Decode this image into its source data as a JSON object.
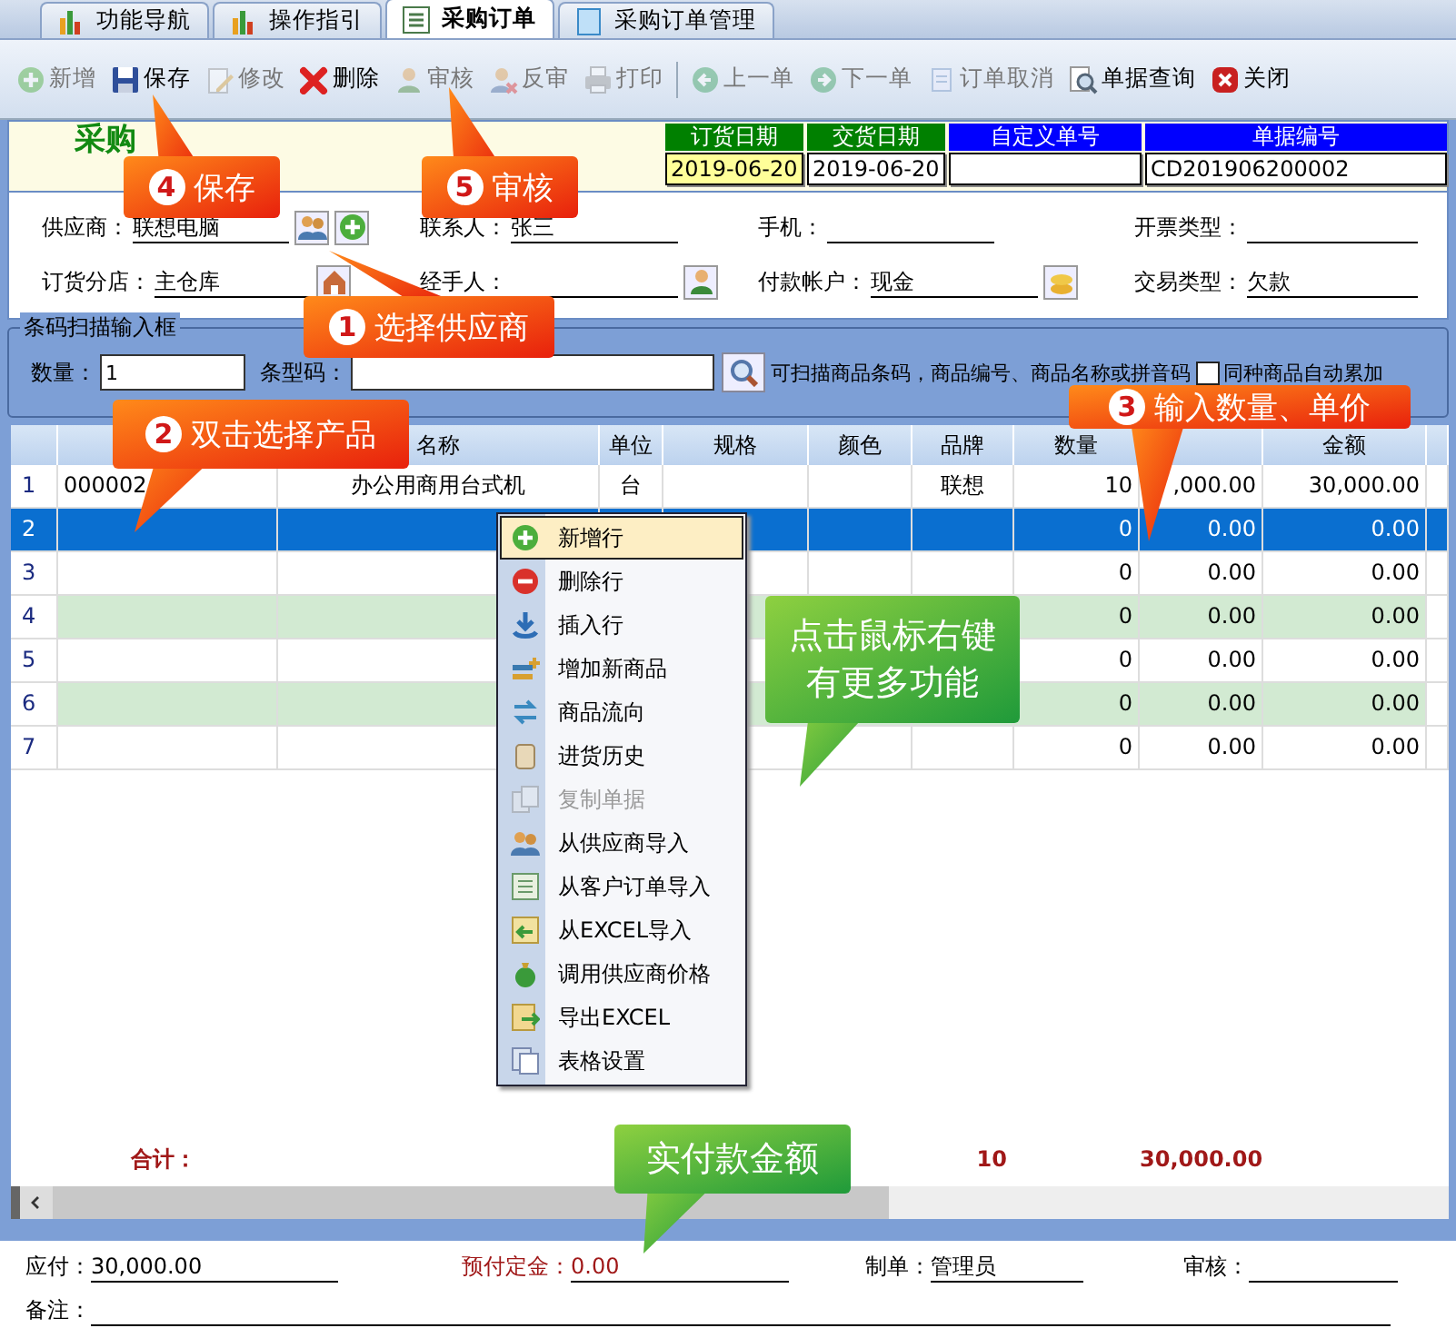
{
  "tabs": [
    {
      "label": "功能导航",
      "selected": false
    },
    {
      "label": "操作指引",
      "selected": false
    },
    {
      "label": "采购订单",
      "selected": true
    },
    {
      "label": "采购订单管理",
      "selected": false
    }
  ],
  "toolbar": [
    {
      "label": "新增",
      "disabled": true
    },
    {
      "label": "保存",
      "disabled": false
    },
    {
      "label": "修改",
      "disabled": true
    },
    {
      "label": "删除",
      "disabled": false
    },
    {
      "label": "审核",
      "disabled": true
    },
    {
      "label": "反审",
      "disabled": true
    },
    {
      "label": "打印",
      "disabled": true
    },
    {
      "label": "上一单",
      "disabled": true
    },
    {
      "label": "下一单",
      "disabled": true
    },
    {
      "label": "订单取消",
      "disabled": true
    },
    {
      "label": "单据查询",
      "disabled": false
    },
    {
      "label": "关闭",
      "disabled": false
    }
  ],
  "header": {
    "title": "采购",
    "dates": [
      {
        "label": "订货日期",
        "value": "2019-06-20",
        "color": "#008000",
        "highlighted": true
      },
      {
        "label": "交货日期",
        "value": "2019-06-20",
        "color": "#008000",
        "highlighted": false
      },
      {
        "label": "自定义单号",
        "color": "#0000ff",
        "highlighted": false
      },
      {
        "label": "单据编号",
        "value": "CD201906200002",
        "color": "#0000ff",
        "highlighted": false
      }
    ]
  },
  "form": {
    "rows": [
      [
        {
          "label": "供应商：",
          "value": "联想电脑"
        },
        {
          "label": "联系人：",
          "value": "张三"
        },
        {
          "label": "手机："
        },
        {
          "label": "开票类型："
        }
      ],
      [
        {
          "label": "订货分店：",
          "value": "主仓库"
        },
        {
          "label": "经手人："
        },
        {
          "label": "付款帐户：",
          "value": "现金"
        },
        {
          "label": "交易类型：",
          "value": "欠款"
        }
      ]
    ]
  },
  "barcode": {
    "title": "条码扫描输入框",
    "quantity_label": "数量：",
    "quantity": "1",
    "code_label": "条型码：",
    "hint": "可扫描商品条码，商品编号、商品名称或拼音码",
    "auto_sum": {
      "label": "同种商品自动累加",
      "checked": false
    }
  },
  "table": {
    "column_headers": {
      "name": "名称",
      "unit": "单位",
      "spec": "规格",
      "colour": "颜色",
      "brand": "品牌",
      "qty": "数量",
      "amount": "金额"
    },
    "rows": [
      {
        "number": "1",
        "code": "000002",
        "name": "办公用商用台式机",
        "unit": "台",
        "brand": "联想",
        "qty": "10",
        "price": ",000.00",
        "amount": "30,000.00",
        "selected": false,
        "shaded": false
      },
      {
        "number": "2",
        "qty": "0",
        "price": "0.00",
        "amount": "0.00",
        "selected": true,
        "shaded": false
      },
      {
        "number": "3",
        "qty": "0",
        "price": "0.00",
        "amount": "0.00",
        "selected": false,
        "shaded": false
      },
      {
        "number": "4",
        "qty": "0",
        "price": "0.00",
        "amount": "0.00",
        "selected": false,
        "shaded": true
      },
      {
        "number": "5",
        "qty": "0",
        "price": "0.00",
        "amount": "0.00",
        "selected": false,
        "shaded": false
      },
      {
        "number": "6",
        "qty": "0",
        "price": "0.00",
        "amount": "0.00",
        "selected": false,
        "shaded": true
      },
      {
        "number": "7",
        "qty": "0",
        "price": "0.00",
        "amount": "0.00",
        "selected": false,
        "shaded": false
      }
    ],
    "total": {
      "label": "合计：",
      "qty": "10",
      "amount": "30,000.00"
    }
  },
  "context_menu": [
    {
      "label": "新增行",
      "selected": true,
      "disabled": false
    },
    {
      "label": "删除行",
      "selected": false,
      "disabled": false
    },
    {
      "label": "插入行",
      "selected": false,
      "disabled": false
    },
    {
      "label": "增加新商品",
      "selected": false,
      "disabled": false
    },
    {
      "label": "商品流向",
      "selected": false,
      "disabled": false
    },
    {
      "label": "进货历史",
      "selected": false,
      "disabled": false
    },
    {
      "label": "复制单据",
      "selected": false,
      "disabled": true
    },
    {
      "label": "从供应商导入",
      "selected": false,
      "disabled": false
    },
    {
      "label": "从客户订单导入",
      "selected": false,
      "disabled": false
    },
    {
      "label": "从EXCEL导入",
      "selected": false,
      "disabled": false
    },
    {
      "label": "调用供应商价格",
      "selected": false,
      "disabled": false
    },
    {
      "label": "导出EXCEL",
      "selected": false,
      "disabled": false
    },
    {
      "label": "表格设置",
      "selected": false,
      "disabled": false
    }
  ],
  "footer": [
    {
      "label": "应付：",
      "value": "30,000.00",
      "highlighted": false
    },
    {
      "label": "预付定金：",
      "value": "0.00",
      "highlighted": true
    },
    {
      "label": "制单：",
      "value": "管理员",
      "highlighted": false
    },
    {
      "label": "审核：",
      "highlighted": false
    }
  ],
  "remark": {
    "label": "备注："
  },
  "callouts": [
    {
      "kind": "step",
      "number": "4",
      "text": "保存"
    },
    {
      "kind": "step",
      "number": "5",
      "text": "审核"
    },
    {
      "kind": "step",
      "number": "1",
      "text": "选择供应商"
    },
    {
      "kind": "step",
      "number": "2",
      "text": "双击选择产品"
    },
    {
      "kind": "step",
      "number": "3",
      "text": "输入数量、单价"
    },
    {
      "kind": "note",
      "text": "点击鼠标右键有更多功能"
    },
    {
      "kind": "note",
      "text": "实付款金额"
    }
  ]
}
